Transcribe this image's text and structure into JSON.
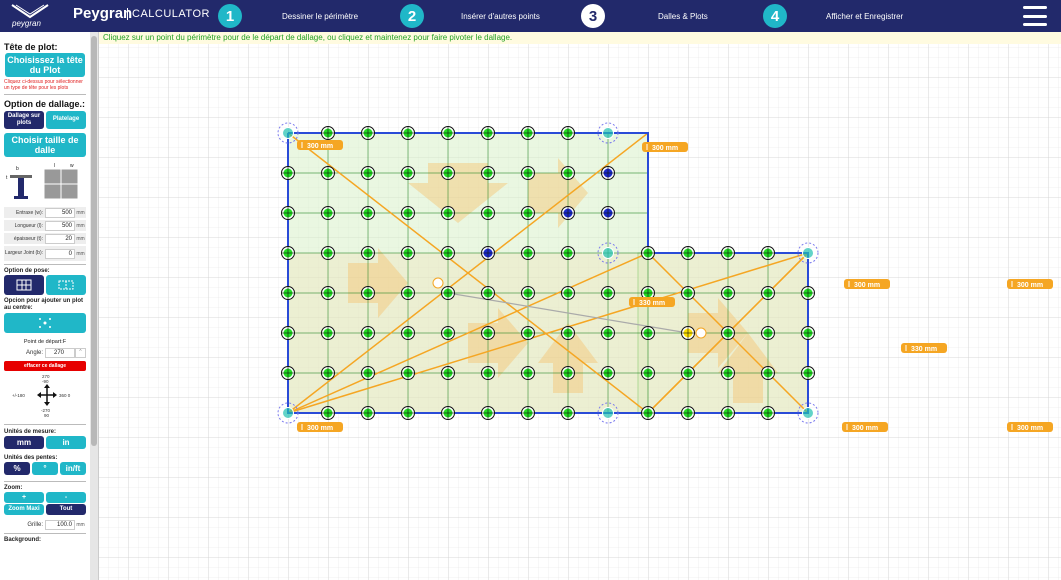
{
  "header": {
    "logo_sub": "peygran",
    "brand": "Peygran",
    "brand_calc": "CALCULATOR",
    "steps": [
      {
        "num": "1",
        "label": "Dessiner le périmètre"
      },
      {
        "num": "2",
        "label": "Insérer d'autres points"
      },
      {
        "num": "3",
        "label": "Dalles & Plots"
      },
      {
        "num": "4",
        "label": "Afficher et Enregistrer"
      }
    ],
    "active_step": 3
  },
  "sidebar": {
    "plot_head_title": "Tête de plot:",
    "plot_head_button": "Choisissez la tête du Plot",
    "plot_head_note": "Cliquez ci-dessus pour sélectionner un type de tête pour les plots",
    "paving_option_title": "Option de dallage.:",
    "paving_seg": [
      "Dallage sur plots",
      "Platelage"
    ],
    "size_button": "Choisir taille de dalle",
    "dims": {
      "b": "b",
      "t": "t",
      "l": "l",
      "w": "w"
    },
    "fields": [
      {
        "label": "Entraxe (w):",
        "value": "500",
        "unit": "mm"
      },
      {
        "label": "Longueur (l):",
        "value": "500",
        "unit": "mm"
      },
      {
        "label": "épaisseur (t):",
        "value": "20",
        "unit": "mm"
      },
      {
        "label": "Largeur Joint (b):",
        "value": "0",
        "unit": "mm"
      }
    ],
    "pose_title": "Option de pose:",
    "center_title": "Opcion pour ajouter un plot au centre:",
    "start_point": "Point de départ:F",
    "angle_label": "Angle:",
    "angle_value": "270",
    "clear_button": "effacer ce dallage",
    "compass": {
      "top": "270",
      "top2": "-90",
      "left": "+/-180",
      "right": "360 0",
      "bottom": "-270",
      "bottom2": "90"
    },
    "units_title": "Unités de mesure:",
    "units": [
      "mm",
      "in"
    ],
    "slope_title": "Unités des pentes:",
    "slopes": [
      "%",
      "°",
      "in/ft"
    ],
    "zoom_title": "Zoom:",
    "zoom_plus": "+",
    "zoom_minus": "-",
    "zoom_max": "Zoom Maxi",
    "zoom_all": "Tout",
    "grid_label": "Grille:",
    "grid_value": "100.0",
    "grid_unit": "mm",
    "background_title": "Background:"
  },
  "canvas": {
    "banner": "Cliquez sur un point du périmètre pour de le départ de dallage, ou cliquez et maintenez pour faire pivoter le dallage.",
    "dimension_label": "300 mm",
    "diag_label": "330 mm"
  },
  "colors": {
    "navy": "#22296b",
    "teal": "#20b7c8",
    "orange": "#f5a623",
    "green_dot": "#22dd22",
    "blue_dot": "#1a2acc",
    "perimeter": "#2a4bd7"
  }
}
